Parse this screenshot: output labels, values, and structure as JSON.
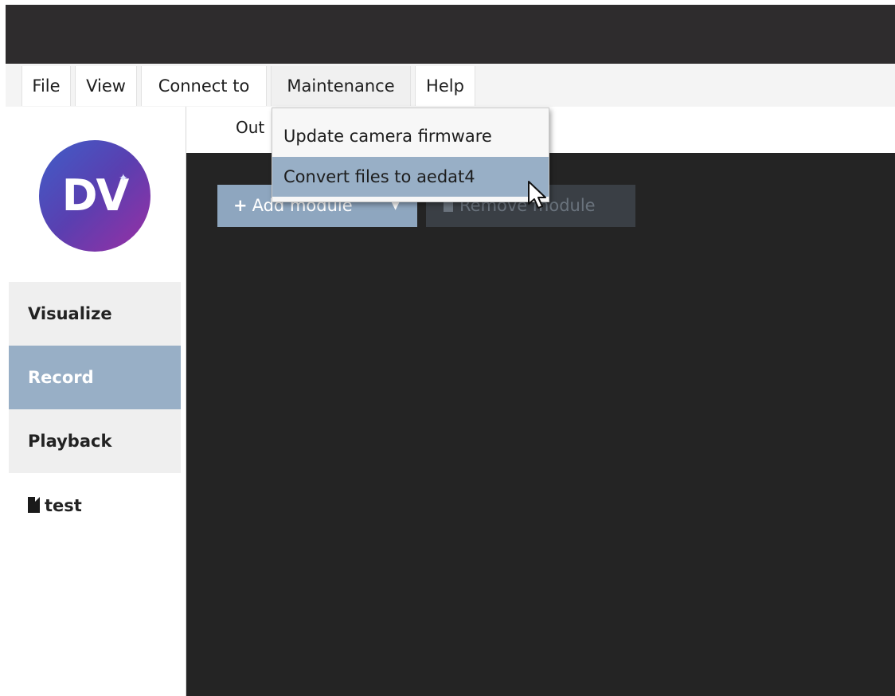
{
  "menubar": {
    "items": [
      {
        "label": "File"
      },
      {
        "label": "View"
      },
      {
        "label": "Connect to"
      },
      {
        "label": "Maintenance"
      },
      {
        "label": "Help"
      }
    ]
  },
  "maintenance_menu": {
    "items": [
      {
        "label": "Update camera firmware"
      },
      {
        "label": "Convert files to aedat4"
      }
    ],
    "highlighted_index": 1
  },
  "logo": {
    "text": "DV"
  },
  "sidebar": {
    "items": [
      {
        "label": "Visualize",
        "active": false
      },
      {
        "label": "Record",
        "active": true
      },
      {
        "label": "Playback",
        "active": false
      }
    ],
    "file": {
      "label": "test",
      "icon": "file-icon"
    }
  },
  "main": {
    "tab_label": "Out",
    "add_module_label": "Add module",
    "remove_module_label": "Remove module"
  },
  "colors": {
    "titlebar": "#2e2c2d",
    "accent": "#98afc6",
    "workspace": "#242424"
  }
}
